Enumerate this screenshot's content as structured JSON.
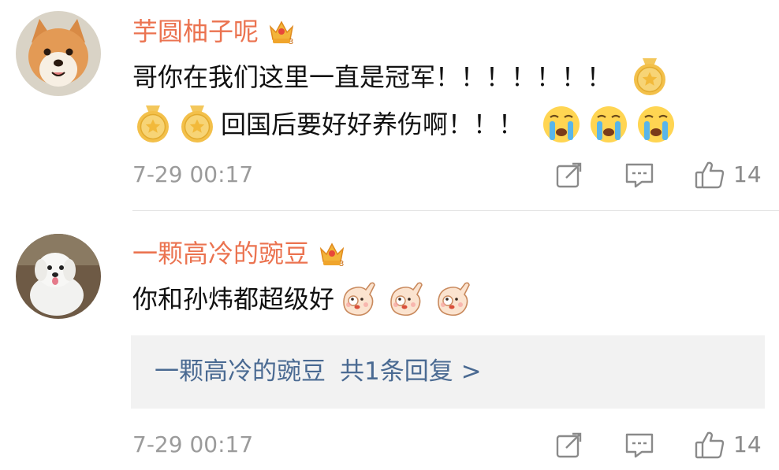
{
  "comments": [
    {
      "username": "芋圆柚子呢",
      "text_line1": "哥你在我们这里一直是冠军！！！！！！！",
      "text_line2": "回国后要好好养伤啊！！！",
      "timestamp": "7-29 00:17",
      "likes": "14"
    },
    {
      "username": "一颗高冷的豌豆",
      "text_line1": "你和孙炜都超级好",
      "timestamp": "7-29 00:17",
      "likes": "14",
      "reply": {
        "author": "一颗高冷的豌豆",
        "count_label": "共1条回复 >"
      }
    }
  ],
  "icons": {
    "vip": "crown-badge-icon",
    "medal": "gold-medal-emoji-icon",
    "crying": "crying-face-emoji-icon",
    "ok_hand": "ok-hand-emoji-icon",
    "share": "share-icon",
    "comment": "comment-icon",
    "like": "thumbs-up-icon"
  },
  "colors": {
    "username": "#eb7350",
    "timestamp": "#9b9b9b",
    "reply_link": "#4a6a92",
    "reply_bg": "#f2f2f2"
  }
}
